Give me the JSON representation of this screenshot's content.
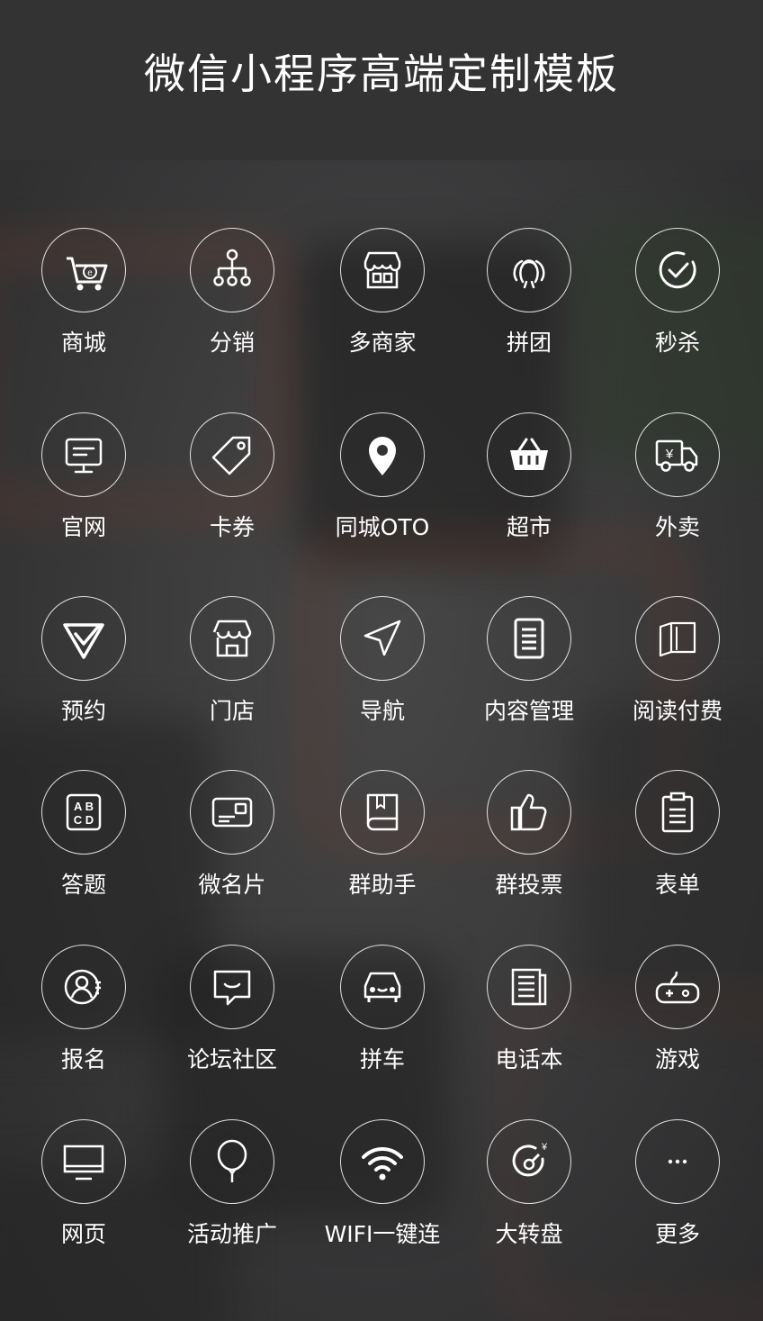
{
  "header": {
    "title": "微信小程序高端定制模板"
  },
  "items": [
    {
      "label": "商城",
      "icon": "shopping-cart-icon"
    },
    {
      "label": "分销",
      "icon": "distribution-tree-icon"
    },
    {
      "label": "多商家",
      "icon": "storefront-icon"
    },
    {
      "label": "拼团",
      "icon": "group-people-icon"
    },
    {
      "label": "秒杀",
      "icon": "check-clock-icon"
    },
    {
      "label": "官网",
      "icon": "monitor-icon"
    },
    {
      "label": "卡券",
      "icon": "tag-icon"
    },
    {
      "label": "同城OTO",
      "icon": "location-pin-icon"
    },
    {
      "label": "超市",
      "icon": "basket-icon"
    },
    {
      "label": "外卖",
      "icon": "delivery-truck-icon"
    },
    {
      "label": "预约",
      "icon": "check-triangle-icon"
    },
    {
      "label": "门店",
      "icon": "shop-icon"
    },
    {
      "label": "导航",
      "icon": "navigation-arrow-icon"
    },
    {
      "label": "内容管理",
      "icon": "document-icon"
    },
    {
      "label": "阅读付费",
      "icon": "open-book-icon"
    },
    {
      "label": "答题",
      "icon": "abcd-quiz-icon"
    },
    {
      "label": "微名片",
      "icon": "card-icon"
    },
    {
      "label": "群助手",
      "icon": "book-icon"
    },
    {
      "label": "群投票",
      "icon": "thumbs-up-icon"
    },
    {
      "label": "表单",
      "icon": "clipboard-icon"
    },
    {
      "label": "报名",
      "icon": "user-signup-icon"
    },
    {
      "label": "论坛社区",
      "icon": "chat-bubble-icon"
    },
    {
      "label": "拼车",
      "icon": "car-icon"
    },
    {
      "label": "电话本",
      "icon": "phonebook-icon"
    },
    {
      "label": "游戏",
      "icon": "gamepad-icon"
    },
    {
      "label": "网页",
      "icon": "webpage-screen-icon"
    },
    {
      "label": "活动推广",
      "icon": "balloon-icon"
    },
    {
      "label": "WIFI一键连",
      "icon": "wifi-icon"
    },
    {
      "label": "大转盘",
      "icon": "lucky-wheel-icon"
    },
    {
      "label": "更多",
      "icon": "more-dots-icon"
    }
  ]
}
